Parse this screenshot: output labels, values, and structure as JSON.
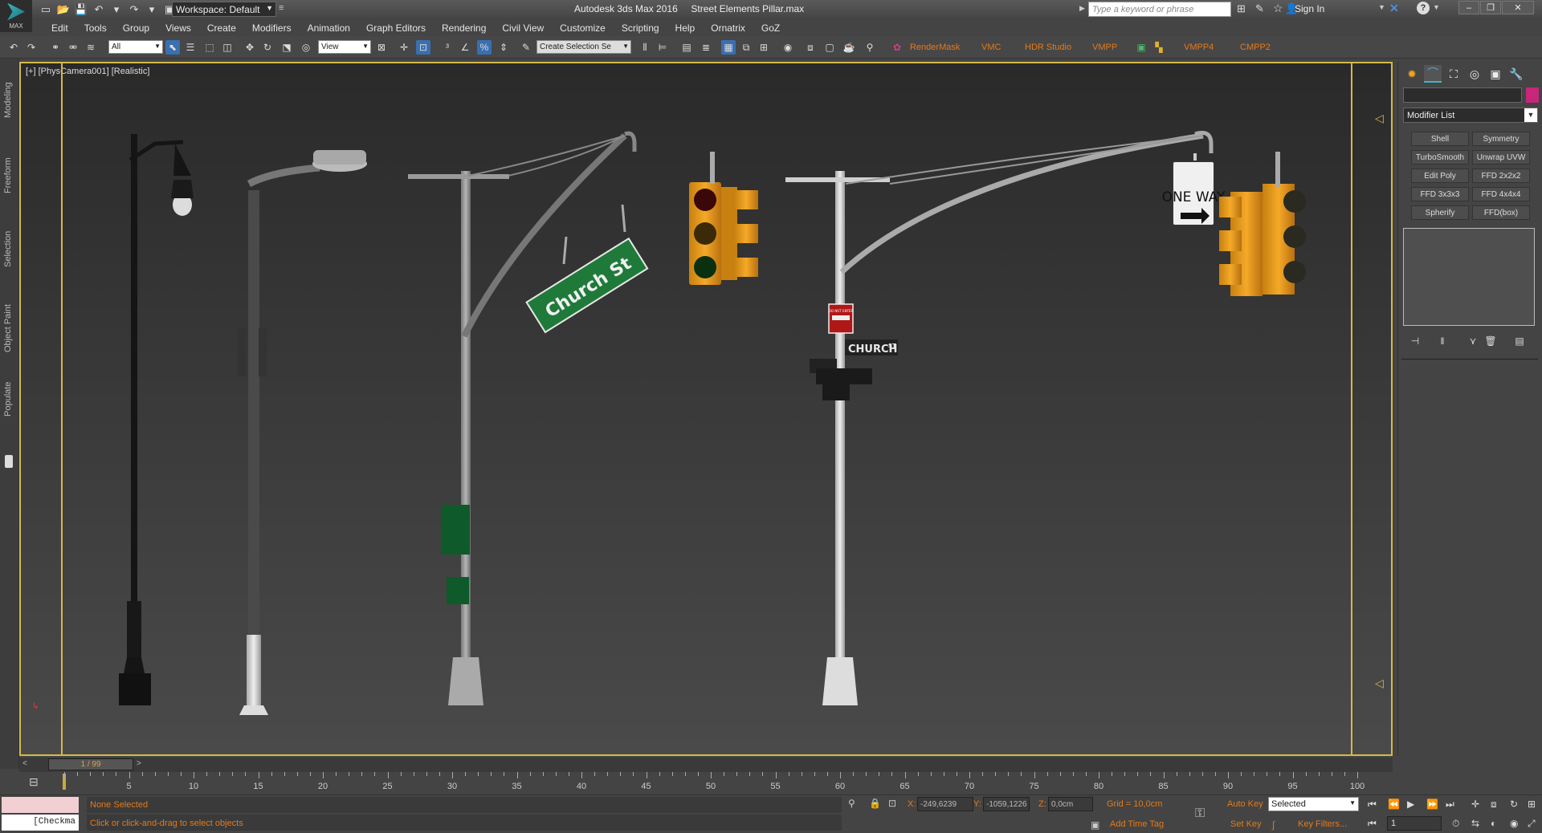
{
  "app": {
    "logo_text": "MAX",
    "workspace": "Workspace: Default",
    "title": "Autodesk 3ds Max 2016",
    "filename": "Street Elements Pillar.max",
    "search_placeholder": "Type a keyword or phrase",
    "sign_in": "Sign In"
  },
  "menu": [
    "Edit",
    "Tools",
    "Group",
    "Views",
    "Create",
    "Modifiers",
    "Animation",
    "Graph Editors",
    "Rendering",
    "Civil View",
    "Customize",
    "Scripting",
    "Help",
    "Ornatrix",
    "GoZ"
  ],
  "toolbar": {
    "filter": "All",
    "ref_coord": "View",
    "selection_set": "Create Selection Se",
    "plugins": [
      "RenderMask",
      "VMC",
      "HDR Studio",
      "VMPP",
      "VMPP4",
      "CMPP2"
    ]
  },
  "left_tabs": [
    "Modeling",
    "Freeform",
    "Selection",
    "Object Paint",
    "Populate"
  ],
  "viewport": {
    "label": "[+] [PhysCamera001] [Realistic]",
    "signs": {
      "church_st_large": "Church St",
      "one_way": "ONE WAY",
      "church_st_small": "CHURCH",
      "church_st_suffix": "ST",
      "do_not_enter": "DO NOT ENTER"
    }
  },
  "command_panel": {
    "modifier_list": "Modifier List",
    "modifiers": [
      "Shell",
      "Symmetry",
      "TurboSmooth",
      "Unwrap UVW",
      "Edit Poly",
      "FFD 2x2x2",
      "FFD 3x3x3",
      "FFD 4x4x4",
      "Spherify",
      "FFD(box)"
    ]
  },
  "time_slider": {
    "position": "1 / 99"
  },
  "trackbar": {
    "labels": [
      5,
      10,
      15,
      20,
      25,
      30,
      35,
      40,
      45,
      50,
      55,
      60,
      65,
      70,
      75,
      80,
      85,
      90,
      95,
      100
    ],
    "max": 100
  },
  "status": {
    "maxscript": "[Checkma",
    "selection": "None Selected",
    "prompt": "Click or click-and-drag to select objects",
    "x_label": "X:",
    "x": "-249,6239",
    "y_label": "Y:",
    "y": "-1059,1226",
    "z_label": "Z:",
    "z": "0,0cm",
    "grid": "Grid = 10,0cm",
    "add_time_tag": "Add Time Tag",
    "auto_key": "Auto Key",
    "set_key": "Set Key",
    "key_mode": "Selected",
    "key_filters": "Key Filters...",
    "frame": "1"
  },
  "colors": {
    "accent_orange": "#e47a1a",
    "viewport_border": "#d5b94a",
    "traffic_light": "#f0a020",
    "street_sign_green": "#1f7a3a"
  }
}
